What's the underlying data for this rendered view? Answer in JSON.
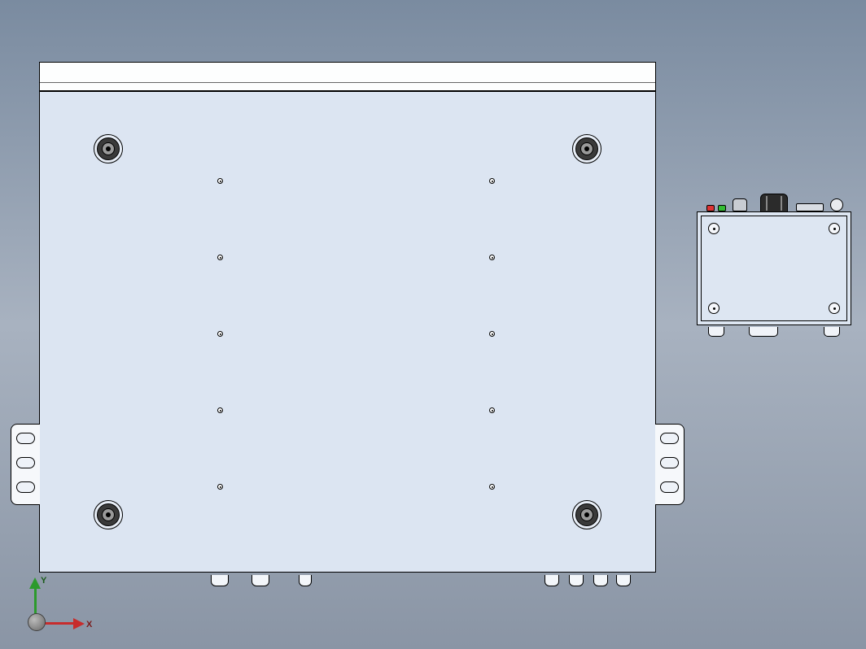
{
  "triad": {
    "x_label": "X",
    "y_label": "Y"
  },
  "model": {
    "main_assembly": {
      "feet": [
        {
          "name": "foot-top-left"
        },
        {
          "name": "foot-top-right"
        },
        {
          "name": "foot-bottom-left"
        },
        {
          "name": "foot-bottom-right"
        }
      ],
      "holes_left_column_count": 5,
      "holes_right_column_count": 5,
      "side_brackets": [
        "left",
        "right"
      ]
    },
    "small_assembly": {
      "corner_holes": 4,
      "top_controls": [
        "red-led",
        "green-led",
        "small-knob",
        "estop-knob",
        "display-slot",
        "jog-wheel"
      ]
    }
  }
}
